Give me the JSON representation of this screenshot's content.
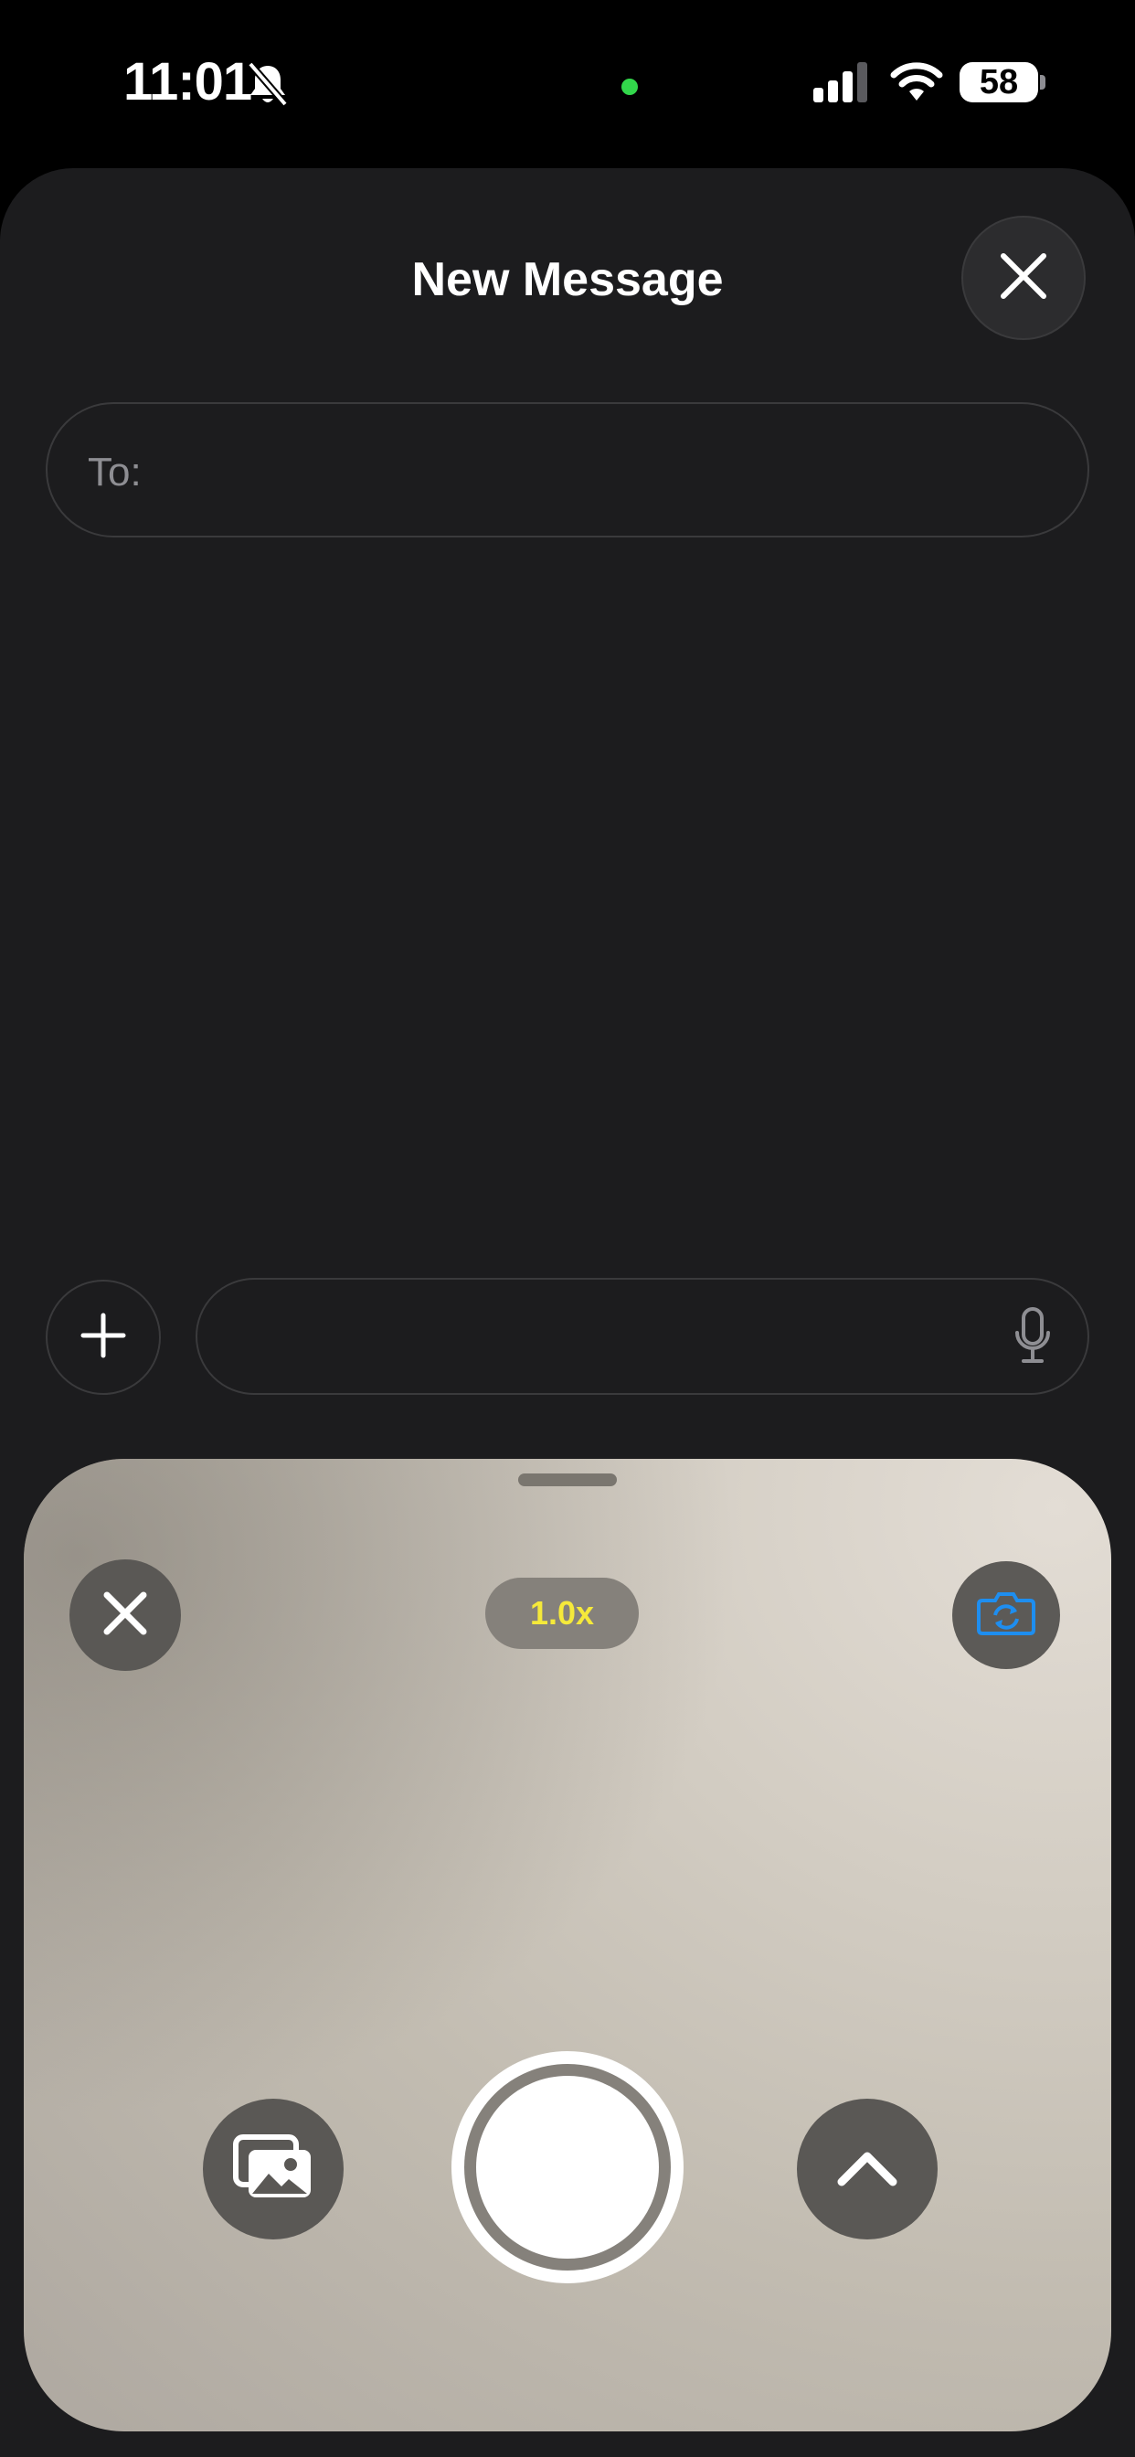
{
  "status_bar": {
    "time": "11:01",
    "battery": "58",
    "icons": [
      "bell-slash-icon",
      "camera-in-use-dot",
      "cellular-signal-icon",
      "wifi-icon",
      "battery-icon"
    ],
    "indicator_color": "#32d74b"
  },
  "compose": {
    "title": "New Message",
    "to_label": "To:",
    "message_value": "",
    "close_icon": "close-icon",
    "add_icon": "plus-icon",
    "mic_icon": "microphone-icon"
  },
  "camera": {
    "zoom": "1.0x",
    "zoom_color": "#f5e93a",
    "flip_icon_color": "#1e8ef0",
    "icons": [
      "close-icon",
      "camera-flip-icon",
      "photo-library-icon",
      "shutter-button",
      "chevron-up-icon"
    ]
  }
}
